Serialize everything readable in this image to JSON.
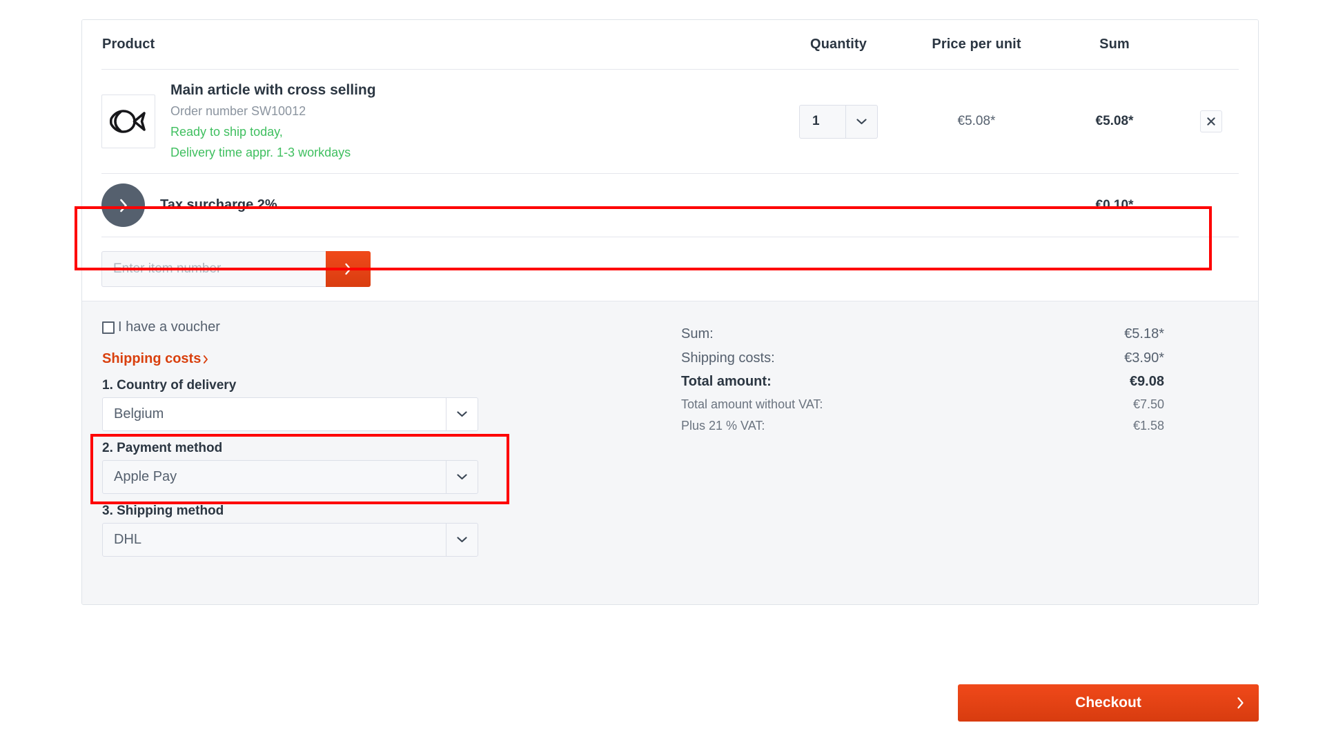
{
  "table": {
    "headers": {
      "product": "Product",
      "quantity": "Quantity",
      "price_per_unit": "Price per unit",
      "sum": "Sum"
    },
    "rows": [
      {
        "title": "Main article with cross selling",
        "order_number": "Order number SW10012",
        "stock_line1": "Ready to ship today,",
        "stock_line2": "Delivery time appr. 1-3 workdays",
        "quantity": "1",
        "price_per_unit": "€5.08*",
        "sum": "€5.08*",
        "remove_label": "✕"
      }
    ],
    "surcharge": {
      "title": "Tax surcharge 2%",
      "sum": "€0.10*"
    }
  },
  "add_item": {
    "placeholder": "Enter item number",
    "value": "",
    "submit_label": "›"
  },
  "footer": {
    "voucher_label": "I have a voucher",
    "shipping_link": "Shipping costs",
    "fields": [
      {
        "label": "1. Country of delivery",
        "value": "Belgium",
        "highlighted": true
      },
      {
        "label": "2. Payment method",
        "value": "Apple Pay",
        "highlighted": false
      },
      {
        "label": "3. Shipping method",
        "value": "DHL",
        "highlighted": false
      }
    ],
    "totals": [
      {
        "label": "Sum:",
        "value": "€5.18*",
        "style": "normal"
      },
      {
        "label": "Shipping costs:",
        "value": "€3.90*",
        "style": "normal"
      },
      {
        "label": "Total amount:",
        "value": "€9.08",
        "style": "strong"
      },
      {
        "label": "Total amount without VAT:",
        "value": "€7.50",
        "style": "small"
      },
      {
        "label": "Plus 21 % VAT:",
        "value": "€1.58",
        "style": "small"
      }
    ]
  },
  "checkout": {
    "label": "Checkout"
  },
  "colors": {
    "accent_orange": "#d9400e",
    "highlight_red": "#fe0000",
    "stock_green": "#3fbf5f",
    "slate": "#55606e",
    "dark_text": "#2b3642"
  }
}
